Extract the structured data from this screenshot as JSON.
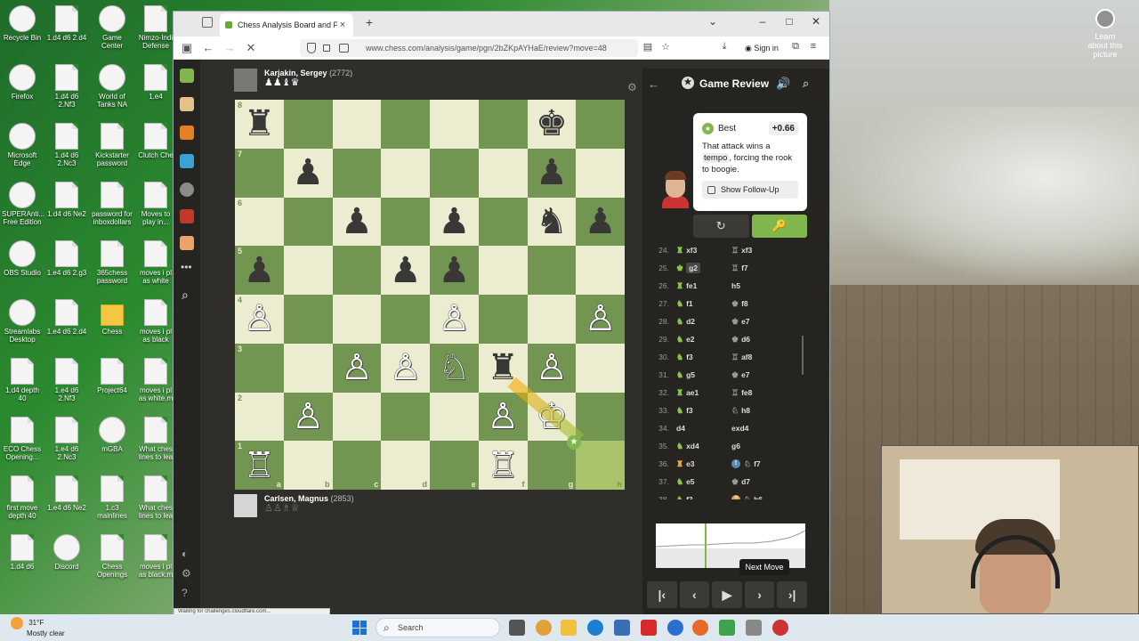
{
  "desktop": {
    "icons_col1": [
      "Recycle Bin",
      "Firefox",
      "Microsoft Edge",
      "SUPERAnti... Free Edition",
      "OBS Studio",
      "Streamlabs Desktop",
      "1.d4 depth 40",
      "ECO Chess Opening...",
      "first move depth 40",
      "1.d4 d6"
    ],
    "icons_col2": [
      "1.d4 d6 2.d4",
      "1.d4 d6 2.Nf3",
      "1.d4 d6 2.Nc3",
      "1.d4 d6 Ne2",
      "1.e4 d6 2.g3",
      "1.e4 d6 2.d4",
      "1.e4 d6 2.Nf3",
      "1.e4 d6 2.Nc3",
      "1.e4 d6 Ne2",
      "Discord"
    ],
    "icons_col3": [
      "Game Center",
      "World of Tanks NA",
      "Kickstarter password",
      "password for inboxdollars",
      "365chess password",
      "Chess",
      "Project64",
      "mGBA",
      "1.c3 mainlines",
      "Chess Openings"
    ],
    "icons_col4": [
      "Nimzo-Indi Defense",
      "1.e4",
      "Clutch Che",
      "Moves to play in...",
      "moves i pl as white",
      "moves i pl as black",
      "moves i pl as white.m",
      "What ches lines to lea",
      "What ches lines to lea",
      "moves i pl as black.m"
    ],
    "learn_about": "Learn about this picture"
  },
  "browser": {
    "tab_title": "Chess Analysis Board and P",
    "url": "www.chess.com/analysis/game/pgn/2bZKpAYHaE/review?move=48",
    "sign_in": "Sign in",
    "status_text": "Waiting for challenges.cloudflare.com..."
  },
  "players": {
    "top": {
      "name": "Karjakin, Sergey",
      "rating": "(2772)",
      "captured": "♟♟♝♛"
    },
    "bottom": {
      "name": "Carlsen, Magnus",
      "rating": "(2853)",
      "captured": "♙♙♗♕"
    }
  },
  "board": {
    "rows": [
      [
        "♜",
        "",
        "",
        "",
        "",
        "",
        "♚",
        ""
      ],
      [
        "",
        "♟",
        "",
        "",
        "",
        "",
        "♟",
        ""
      ],
      [
        "",
        "",
        "♟",
        "",
        "♟",
        "",
        "♞",
        "♟"
      ],
      [
        "♟",
        "",
        "",
        "♟",
        "♟",
        "",
        "",
        ""
      ],
      [
        "♙",
        "",
        "",
        "",
        "♙",
        "",
        "",
        "♙"
      ],
      [
        "",
        "",
        "♙",
        "♙",
        "♘",
        "♜",
        "♙",
        ""
      ],
      [
        "",
        "♙",
        "",
        "",
        "",
        "♙",
        "♔",
        ""
      ],
      [
        "♖",
        "",
        "",
        "",
        "",
        "♖",
        "",
        ""
      ]
    ],
    "colors": [
      [
        "b",
        "",
        "",
        "",
        "",
        "",
        "b",
        ""
      ],
      [
        "",
        "b",
        "",
        "",
        "",
        "",
        "b",
        ""
      ],
      [
        "",
        "",
        "b",
        "",
        "b",
        "",
        "b",
        "b"
      ],
      [
        "b",
        "",
        "",
        "b",
        "b",
        "",
        "",
        ""
      ],
      [
        "w",
        "",
        "",
        "",
        "w",
        "",
        "",
        "w"
      ],
      [
        "",
        "",
        "w",
        "w",
        "w",
        "b",
        "w",
        ""
      ],
      [
        "",
        "w",
        "",
        "",
        "",
        "w",
        "w",
        ""
      ],
      [
        "w",
        "",
        "",
        "",
        "",
        "w",
        "",
        ""
      ]
    ],
    "ranks": [
      "8",
      "7",
      "6",
      "5",
      "4",
      "3",
      "2",
      "1"
    ],
    "files": [
      "a",
      "b",
      "c",
      "d",
      "e",
      "f",
      "g",
      "h"
    ]
  },
  "review": {
    "title": "Game Review",
    "best_label": "Best",
    "eval": "+0.66",
    "comment_pre": "That attack wins a",
    "comment_code": "tempo",
    "comment_post": ", forcing the rook to boogie.",
    "follow_up": "Show Follow-Up",
    "retry_icon": "↻",
    "key_icon": "🔑",
    "moves": [
      {
        "n": "24.",
        "w": "xf3",
        "b": "xf3"
      },
      {
        "n": "25.",
        "w": "g2",
        "b": "f7"
      },
      {
        "n": "26.",
        "w": "fe1",
        "b": "h5"
      },
      {
        "n": "27.",
        "w": "f1",
        "b": "f8"
      },
      {
        "n": "28.",
        "w": "d2",
        "b": "e7"
      },
      {
        "n": "29.",
        "w": "e2",
        "b": "d6"
      },
      {
        "n": "30.",
        "w": "f3",
        "b": "af8"
      },
      {
        "n": "31.",
        "w": "g5",
        "b": "e7"
      },
      {
        "n": "32.",
        "w": "ae1",
        "b": "fe8"
      },
      {
        "n": "33.",
        "w": "f3",
        "b": "h8"
      },
      {
        "n": "34.",
        "w": "d4",
        "b": "exd4"
      },
      {
        "n": "35.",
        "w": "xd4",
        "b": "g6"
      },
      {
        "n": "36.",
        "w": "e3",
        "b": "f7"
      },
      {
        "n": "37.",
        "w": "e5",
        "b": "d7"
      },
      {
        "n": "38.",
        "w": "f3",
        "b": "h6"
      }
    ],
    "tooltip": "Next Move"
  },
  "taskbar": {
    "temp": "31°F",
    "weather": "Mostly clear",
    "search": "Search"
  }
}
